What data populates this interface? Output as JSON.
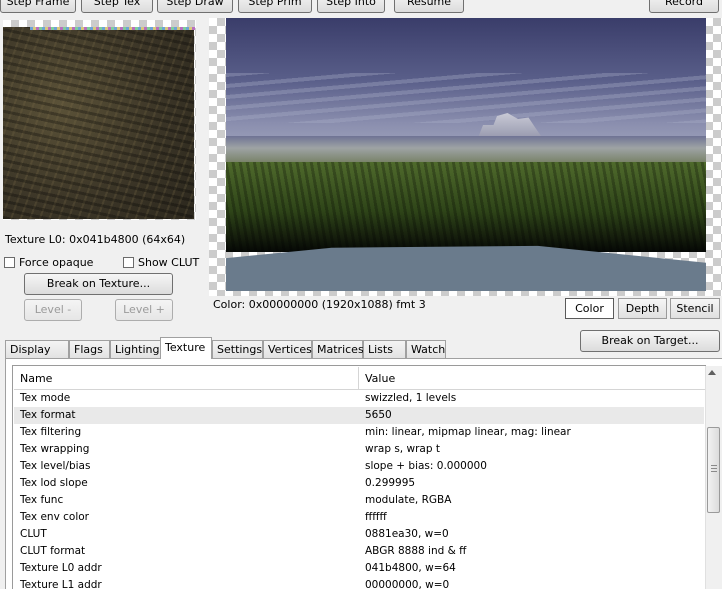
{
  "toolbar": {
    "step_frame": "Step Frame",
    "step_tex": "Step Tex",
    "step_draw": "Step Draw",
    "step_prim": "Step Prim",
    "step_into": "Step Into",
    "resume": "Resume",
    "record": "Record"
  },
  "texture_panel": {
    "label": "Texture L0: 0x041b4800 (64x64)",
    "force_opaque": "Force opaque",
    "show_clut": "Show CLUT",
    "break_on_texture": "Break on Texture...",
    "level_minus": "Level -",
    "level_plus": "Level +"
  },
  "frame_panel": {
    "label": "Color: 0x00000000 (1920x1088) fmt 3",
    "buffer_tabs": [
      "Color",
      "Depth",
      "Stencil"
    ],
    "break_on_target": "Break on Target..."
  },
  "tabs": [
    "Display List",
    "Flags",
    "Lighting",
    "Texture",
    "Settings",
    "Vertices",
    "Matrices",
    "Lists",
    "Watch"
  ],
  "active_tab": "Texture",
  "table": {
    "headers": {
      "name": "Name",
      "value": "Value"
    },
    "rows": [
      {
        "name": "Tex mode",
        "value": "swizzled, 1 levels"
      },
      {
        "name": "Tex format",
        "value": "5650"
      },
      {
        "name": "Tex filtering",
        "value": "min: linear, mipmap linear, mag: linear"
      },
      {
        "name": "Tex wrapping",
        "value": "wrap s, wrap t"
      },
      {
        "name": "Tex level/bias",
        "value": "slope + bias: 0.000000"
      },
      {
        "name": "Tex lod slope",
        "value": "0.299995"
      },
      {
        "name": "Tex func",
        "value": "modulate, RGBA"
      },
      {
        "name": "Tex env color",
        "value": "ffffff"
      },
      {
        "name": "CLUT",
        "value": "0881ea30, w=0"
      },
      {
        "name": "CLUT format",
        "value": "ABGR 8888 ind & ff"
      },
      {
        "name": "Texture L0 addr",
        "value": "041b4800, w=64"
      },
      {
        "name": "Texture L1 addr",
        "value": "00000000, w=0"
      }
    ]
  }
}
